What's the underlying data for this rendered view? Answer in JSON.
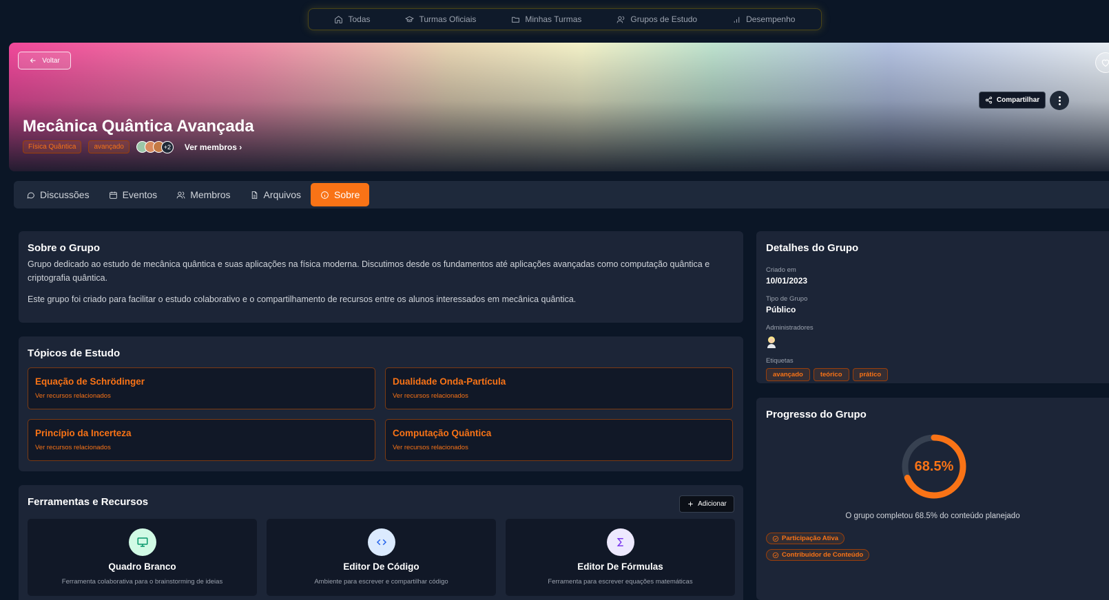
{
  "topnav": {
    "items": [
      {
        "label": "Todas",
        "icon": "home-icon"
      },
      {
        "label": "Turmas Oficiais",
        "icon": "graduation-cap-icon"
      },
      {
        "label": "Minhas Turmas",
        "icon": "folder-icon"
      },
      {
        "label": "Grupos de Estudo",
        "icon": "users-icon"
      },
      {
        "label": "Desempenho",
        "icon": "bar-chart-icon"
      }
    ]
  },
  "hero": {
    "back_label": "Voltar",
    "title": "Mecânica Quântica Avançada",
    "tags": [
      "Física Quântica",
      "avançado"
    ],
    "members_extra": "+2",
    "see_members": "Ver membros",
    "share_label": "Compartilhar"
  },
  "tabs": [
    {
      "label": "Discussões",
      "icon": "message-circle-icon"
    },
    {
      "label": "Eventos",
      "icon": "calendar-icon"
    },
    {
      "label": "Membros",
      "icon": "users-icon"
    },
    {
      "label": "Arquivos",
      "icon": "file-text-icon"
    },
    {
      "label": "Sobre",
      "icon": "info-icon",
      "active": true
    }
  ],
  "about": {
    "title": "Sobre o Grupo",
    "paragraphs": [
      "Grupo dedicado ao estudo de mecânica quântica e suas aplicações na física moderna. Discutimos desde os fundamentos até aplicações avançadas como computação quântica e criptografia quântica.",
      "Este grupo foi criado para facilitar o estudo colaborativo e o compartilhamento de recursos entre os alunos interessados em mecânica quântica."
    ]
  },
  "topics": {
    "title": "Tópicos de Estudo",
    "items": [
      {
        "title": "Equação de Schrödinger",
        "link": "Ver recursos relacionados"
      },
      {
        "title": "Dualidade Onda-Partícula",
        "link": "Ver recursos relacionados"
      },
      {
        "title": "Princípio da Incerteza",
        "link": "Ver recursos relacionados"
      },
      {
        "title": "Computação Quântica",
        "link": "Ver recursos relacionados"
      }
    ]
  },
  "tools": {
    "title": "Ferramentas e Recursos",
    "add_label": "Adicionar",
    "items": [
      {
        "name": "Quadro Branco",
        "desc": "Ferramenta colaborativa para o brainstorming de ideias",
        "icon": "monitor-icon",
        "bg": "#d1fae5",
        "fg": "#059669"
      },
      {
        "name": "Editor De Código",
        "desc": "Ambiente para escrever e compartilhar código",
        "icon": "code-icon",
        "bg": "#dbeafe",
        "fg": "#2563eb"
      },
      {
        "name": "Editor De Fórmulas",
        "desc": "Ferramenta para escrever equações matemáticas",
        "icon": "sigma-icon",
        "bg": "#ede9fe",
        "fg": "#7c3aed"
      }
    ]
  },
  "details": {
    "title": "Detalhes do Grupo",
    "created_label": "Criado em",
    "created_value": "10/01/2023",
    "type_label": "Tipo de Grupo",
    "type_value": "Público",
    "admins_label": "Administradores",
    "tags_label": "Etiquetas",
    "tags": [
      "avançado",
      "teórico",
      "prático"
    ]
  },
  "progress": {
    "title": "Progresso do Grupo",
    "value_label": "68.5%",
    "fraction": 0.685,
    "description": "O grupo completou 68.5% do conteúdo planejado",
    "badges": [
      "Participação Ativa",
      "Contribuidor de Conteúdo"
    ]
  },
  "colors": {
    "accent": "#f97316",
    "background": "#0b1626",
    "card": "#1c2537"
  }
}
